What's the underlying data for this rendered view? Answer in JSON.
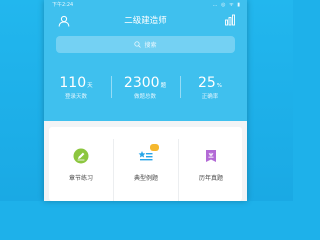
{
  "status_bar": {
    "time": "下午2:24",
    "icons": "… ◎ ᯤ ▮"
  },
  "header": {
    "title": "二级建造师"
  },
  "search": {
    "placeholder": "搜索"
  },
  "stats": [
    {
      "value": "110",
      "unit": "天",
      "label": "登录天数"
    },
    {
      "value": "2300",
      "unit": "题",
      "label": "做题总数"
    },
    {
      "value": "25",
      "unit": "%",
      "label": "正确率"
    }
  ],
  "features": [
    {
      "label": "章节练习",
      "icon": "pencil-icon",
      "color": "#8cc63f"
    },
    {
      "label": "典型例题",
      "icon": "star-list-icon",
      "color": "#2aa6e8",
      "badge": "例"
    },
    {
      "label": "历年真题",
      "icon": "exam-paper-icon",
      "color": "#b36ad6"
    }
  ],
  "colors": {
    "header": "#3fc0ee",
    "background": "#1eb1ea",
    "search": "#74d1f3"
  }
}
